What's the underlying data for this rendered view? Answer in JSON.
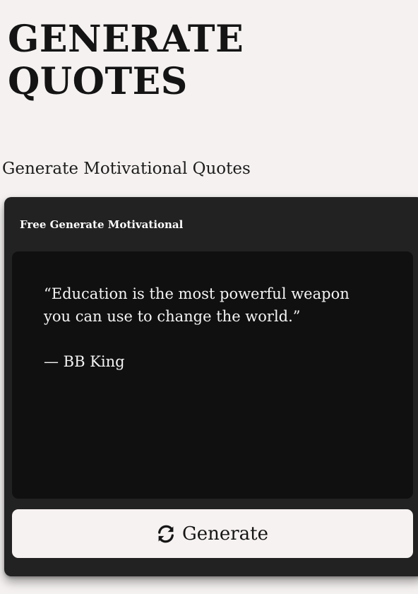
{
  "page": {
    "title": "GENERATE QUOTES",
    "subtitle": "Generate Motivational Quotes"
  },
  "card": {
    "header": "Free Generate Motivational",
    "quote": {
      "text": "“Education is the most powerful weapon you can use to change the world.”",
      "author": "— BB King"
    },
    "button": {
      "label": "Generate",
      "icon": "refresh-icon"
    }
  },
  "colors": {
    "page_background": "#f4f1f0",
    "card_background": "#222222",
    "quote_background": "#101010",
    "button_background": "#f6f2f1",
    "text_light": "#f4f4f4",
    "text_dark": "#141414"
  }
}
